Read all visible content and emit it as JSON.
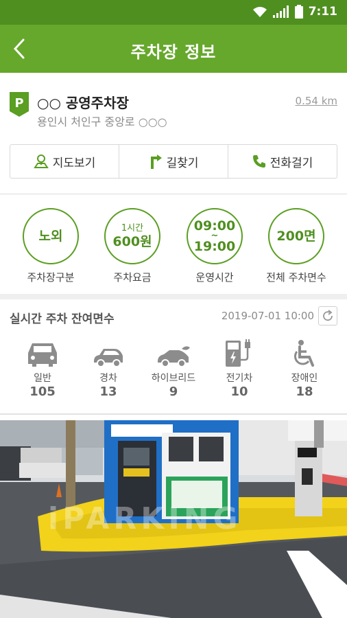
{
  "status_bar": {
    "time": "7:11",
    "icons": [
      "wifi-icon",
      "signal-icon",
      "battery-icon"
    ]
  },
  "header": {
    "title": "주차장 정보",
    "back_icon": "chevron-left-icon"
  },
  "lot": {
    "badge": "P",
    "name": "○○ 공영주차장",
    "address": "용인시 처인구 중앙로 ○○○",
    "distance": "0.54 km"
  },
  "actions": {
    "map_label": "지도보기",
    "route_label": "길찾기",
    "call_label": "전화걸기"
  },
  "summary": {
    "type": {
      "value": "노외",
      "label": "주차장구분"
    },
    "fee": {
      "unit": "1시간",
      "value": "600원",
      "label": "주차요금"
    },
    "hours": {
      "open": "09:00",
      "sep": "~",
      "close": "19:00",
      "label": "운영시간"
    },
    "spaces": {
      "value": "200면",
      "label": "전체 주차면수"
    }
  },
  "realtime": {
    "title": "실시간 주차 잔여면수",
    "updated": "2019-07-01 10:00",
    "categories": [
      {
        "name": "일반",
        "count": "105",
        "icon": "car-icon"
      },
      {
        "name": "경차",
        "count": "13",
        "icon": "compact-car-icon"
      },
      {
        "name": "하이브리드",
        "count": "9",
        "icon": "hybrid-car-icon"
      },
      {
        "name": "전기차",
        "count": "10",
        "icon": "ev-charger-icon"
      },
      {
        "name": "장애인",
        "count": "18",
        "icon": "wheelchair-icon"
      }
    ]
  },
  "photo": {
    "watermark": "iPARKING"
  },
  "colors": {
    "header": "#66a82c",
    "status": "#4f8f1f",
    "accent": "#5a9e22"
  }
}
